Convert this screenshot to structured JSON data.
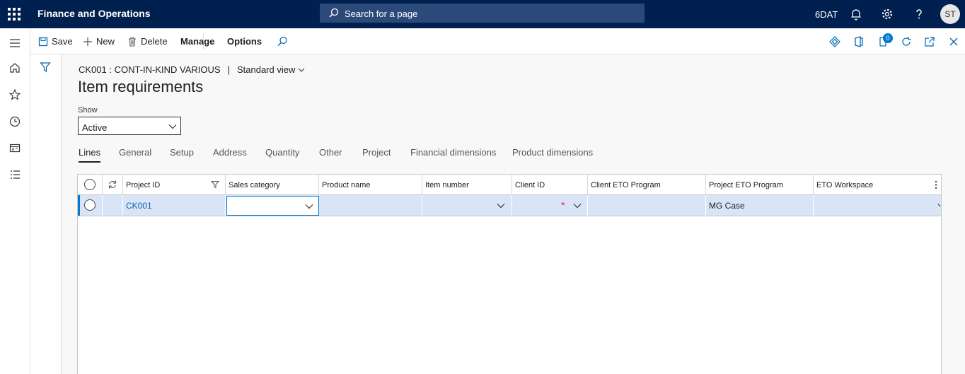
{
  "app": {
    "title": "Finance and Operations",
    "company": "6DAT",
    "user_initials": "ST"
  },
  "search": {
    "placeholder": "Search for a page"
  },
  "toolbar": {
    "save": "Save",
    "new": "New",
    "delete": "Delete",
    "manage": "Manage",
    "options": "Options",
    "notification_count": "0"
  },
  "breadcrumb": {
    "record": "CK001 : CONT-IN-KIND VARIOUS",
    "separator": "|",
    "view": "Standard view"
  },
  "page": {
    "title": "Item requirements"
  },
  "show": {
    "label": "Show",
    "value": "Active"
  },
  "tabs": [
    "Lines",
    "General",
    "Setup",
    "Address",
    "Quantity",
    "Other",
    "Project",
    "Financial dimensions",
    "Product dimensions"
  ],
  "grid": {
    "columns": [
      "Project ID",
      "Sales category",
      "Product name",
      "Item number",
      "Client ID",
      "Client ETO Program",
      "Project ETO Program",
      "ETO Workspace"
    ],
    "rows": [
      {
        "project_id": "CK001",
        "sales_category": "",
        "product_name": "",
        "item_number": "",
        "client_id": "",
        "client_eto_program": "",
        "project_eto_program": "MG Case",
        "eto_workspace": ""
      }
    ]
  }
}
